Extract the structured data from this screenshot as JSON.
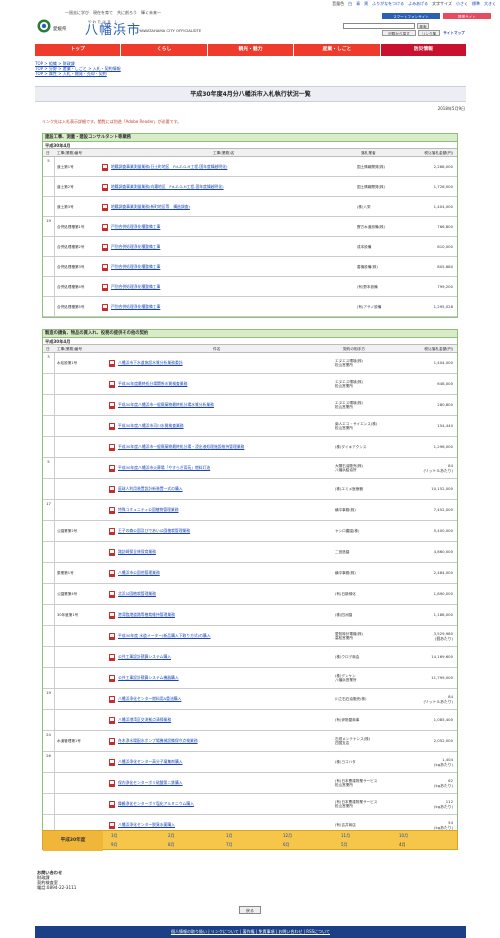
{
  "utility": [
    "音量色",
    "白",
    "青",
    "黒",
    "ふりがなをつける",
    "よみあげる",
    "文字サイズ",
    "小さく",
    "標準",
    "大きく"
  ],
  "header": {
    "tagline": "一過去に学び　現在を育て　共に創ろう　輝く未来一",
    "prefecture": "愛媛県",
    "city_reading": "やわたはま し",
    "city_name": "八幡浜市",
    "city_en": "YAWATAHAMA CITY OFFICIALSITE",
    "smartphone": "スマートフォンサイト",
    "mobile": "携帯サイト",
    "search_button": "検索",
    "search_tip": "記載から探す",
    "links_button": "リンク集",
    "sitemap": "サイトマップ"
  },
  "colors": {
    "nav": "#ef3b2c",
    "nav_active": "#c9102e",
    "section_head": "#d7ecc7",
    "month_bar": "#f6c64a",
    "footer": "#1d3f86"
  },
  "nav": [
    "トップ",
    "くらし",
    "観光・魅力",
    "産業・しごと",
    "防災情報"
  ],
  "breadcrumbs": [
    "TOP > 組織 > 財政課",
    "TOP > 分野 > 産業・しごと > 入札・契約情報",
    "TOP > 属性 > 入札・開発・売却・契約"
  ],
  "page_title": "平成30年度4月分八幡浜市入札執行状況一覧",
  "date": "2018年5月9日",
  "pdf_note": "リンク先は入札表示詳細です。閲覧には別途「Adobe Reader」が必要です。",
  "sec1": {
    "title": "建設工事、測量・建設コンサルタント等業務",
    "month": "平成30年4月",
    "columns": [
      "日",
      "工事(業務)番号",
      "工事(業務)名",
      "落札業者",
      "税込落札金額(円)"
    ],
    "rows": [
      {
        "day": "5",
        "no": "道土第1号",
        "name": "地籍調査事業測量業務(日土町地区　Fd-Z-G-H工程-国年度繰越明化)",
        "winner": "国土情報開発(株)",
        "amount": "2,268,000"
      },
      {
        "day": "",
        "no": "道土第2号",
        "name": "地籍調査事業測量業務(向灘地区　Fd-Z-G-H工程-国年度繰越明化)",
        "winner": "国土情報開発(株)",
        "amount": "1,728,000"
      },
      {
        "day": "",
        "no": "道土第3号",
        "name": "地籍調査事業測量業務(新町地区等　構造調査)",
        "winner": "(株)八栄",
        "amount": "1,404,000"
      },
      {
        "day": "19",
        "no": "合併処理槽第1号",
        "name": "戸別合併処理浄化槽整備工事",
        "winner": "實方水道設備(株)",
        "amount": "766,800"
      },
      {
        "day": "",
        "no": "合併処理槽第2号",
        "name": "戸別合併処理浄化槽整備工事",
        "winner": "成本設備",
        "amount": "810,000"
      },
      {
        "day": "",
        "no": "合併処理槽第3号",
        "name": "戸別合併処理浄化槽整備工事",
        "winner": "善機設備(株)",
        "amount": "805,680"
      },
      {
        "day": "",
        "no": "合併処理槽第4号",
        "name": "戸別合併処理浄化槽整備工事",
        "winner": "(有)野本設備",
        "amount": "799,200"
      },
      {
        "day": "",
        "no": "合併処理槽第5号",
        "name": "戸別合併処理浄化槽整備工事",
        "winner": "(有)アサノ設備",
        "amount": "1,295,028"
      }
    ]
  },
  "sec2": {
    "title": "製造の請負、物品の買入れ、役務の提供その他の契約",
    "month": "平成30年4月",
    "columns": [
      "日",
      "工事(業務)番号",
      "件名",
      "契約の相手方",
      "税込落札金額(円)"
    ],
    "rows": [
      {
        "day": "3",
        "no": "水処設第1号",
        "name": "八幡浜市下水道施設水質分析業務委託",
        "winner": "エヌエス環境(株)\n松山営業所",
        "amount": "1,404,000"
      },
      {
        "day": "",
        "no": "",
        "name": "平成30年度最終処分場関係水質検査業務",
        "winner": "エヌエス環境(株)\n松山営業所",
        "amount": "648,000"
      },
      {
        "day": "",
        "no": "",
        "name": "平成30年度八幡浜市一般廃棄物最終処分場水質分析業務",
        "winner": "エヌエス環境(株)\n松山営業所",
        "amount": "280,800"
      },
      {
        "day": "",
        "no": "",
        "name": "平成30年度八幡浜市河川水質検査業務",
        "winner": "南人エコ・サイエンス(株)\n松山営業所",
        "amount": "154,440"
      },
      {
        "day": "",
        "no": "",
        "name": "平成30年度八幡浜市一般廃棄物最終処分場・浸出液処理施設維持管理業務",
        "winner": "(株)ダイキアクシス",
        "amount": "1,296,000"
      },
      {
        "day": "5",
        "no": "",
        "name": "平成30年度八幡浜市火葬場「やすらぎ斎苑」燃料灯油",
        "winner": "大陽石油販売(株)\n八幡浜給油所",
        "amount": "84\n(リットルあたり)"
      },
      {
        "day": "",
        "no": "",
        "name": "庭球人利用装置設計新装置一式の購入",
        "winner": "(株)エミメ医療器",
        "amount": "10,152,000"
      },
      {
        "day": "17",
        "no": "",
        "name": "特殊コミュニティ公園植物管理業務",
        "winner": "横平事務(株)",
        "amount": "7,452,000"
      },
      {
        "day": "",
        "no": "公園業第2号",
        "name": "王子の森公園及びであい公園植栽管理業務",
        "winner": "ヤシロ農園(株)",
        "amount": "5,400,000"
      },
      {
        "day": "",
        "no": "",
        "name": "諏訪崎保全林保育業務",
        "winner": "二宮造園",
        "amount": "4,860,000"
      },
      {
        "day": "",
        "no": "委業第1号",
        "name": "八幡浜市公園他管理業務",
        "winner": "横平事務(株)",
        "amount": "2,484,000"
      },
      {
        "day": "",
        "no": "公園業第4号",
        "name": "北浜公園植栽管理業務",
        "winner": "(有)日新緑化",
        "amount": "1,890,000"
      },
      {
        "day": "",
        "no": "30年度第1号",
        "name": "港湾臨港道路等植栽維持管理業務",
        "winner": "(株)四洲園",
        "amount": "1,188,000"
      },
      {
        "day": "",
        "no": "",
        "name": "平成30年度 水道メーター(新品購入下取り方式)の購入",
        "winner": "愛知時計電機(株)\n高松営業所",
        "amount": "3,529,980\n(個あたり)"
      },
      {
        "day": "",
        "no": "",
        "name": "公共工事設計積算システム購入",
        "winner": "(株)ウロデ商会",
        "amount": "14,169,600"
      },
      {
        "day": "",
        "no": "",
        "name": "公共工事設計積算システム機器購入",
        "winner": "(株)デンケン\n八幡浜営業所",
        "amount": "11,799,000"
      },
      {
        "day": "19",
        "no": "",
        "name": "八幡浜浄化センター燃料用A重油購入",
        "winner": "川之石石油販売(株)",
        "amount": "84\n(リットルあたり)"
      },
      {
        "day": "",
        "no": "",
        "name": "八幡浜港湾区交流拠点清掃業務",
        "winner": "(有)伊勢屋商事",
        "amount": "1,085,400"
      },
      {
        "day": "24",
        "no": "水道管理第1号",
        "name": "舟木浄水場配水ポンプ場機械設備保守点検業務",
        "winner": "石垣メンテナンス(株)\n四国支店",
        "amount": "2,052,000"
      },
      {
        "day": "26",
        "no": "",
        "name": "八幡浜浄化センター高分子凝集剤購入",
        "winner": "(株)ヨコハタ",
        "amount": "1,404\n(kgあたり)"
      },
      {
        "day": "",
        "no": "",
        "name": "保内浄化センターポリ硫酸第二鉄購入",
        "winner": "(有)日本曹達物業サービス\n松山営業所",
        "amount": "62\n(kgあたり)"
      },
      {
        "day": "",
        "no": "",
        "name": "舞鶴浄化センターポリ塩化アルミニウム購入",
        "winner": "(有)日本曹達物業サービス\n松山営業所",
        "amount": "112\n(kgあたり)"
      },
      {
        "day": "",
        "no": "",
        "name": "八幡浜浄化センター脱臭水薬購入",
        "winner": "(有)吉井商店",
        "amount": "54\n(kgあたり)"
      }
    ]
  },
  "month_nav": {
    "label": "平成30年度",
    "row1": [
      "3月",
      "2月",
      "1月",
      "12月",
      "11月",
      "10月"
    ],
    "row2": [
      "9月",
      "8月",
      "7月",
      "6月",
      "5月",
      "4月"
    ]
  },
  "contact": {
    "heading": "お問い合わせ",
    "dept": "財政課",
    "section": "契約検査室",
    "phone": "電話:0894-22-3111"
  },
  "back_button": "戻る",
  "footer": "個人情報の取り扱い | リンクについて | 著作権 | 免責事項 | お問い合わせ | RSSについて"
}
